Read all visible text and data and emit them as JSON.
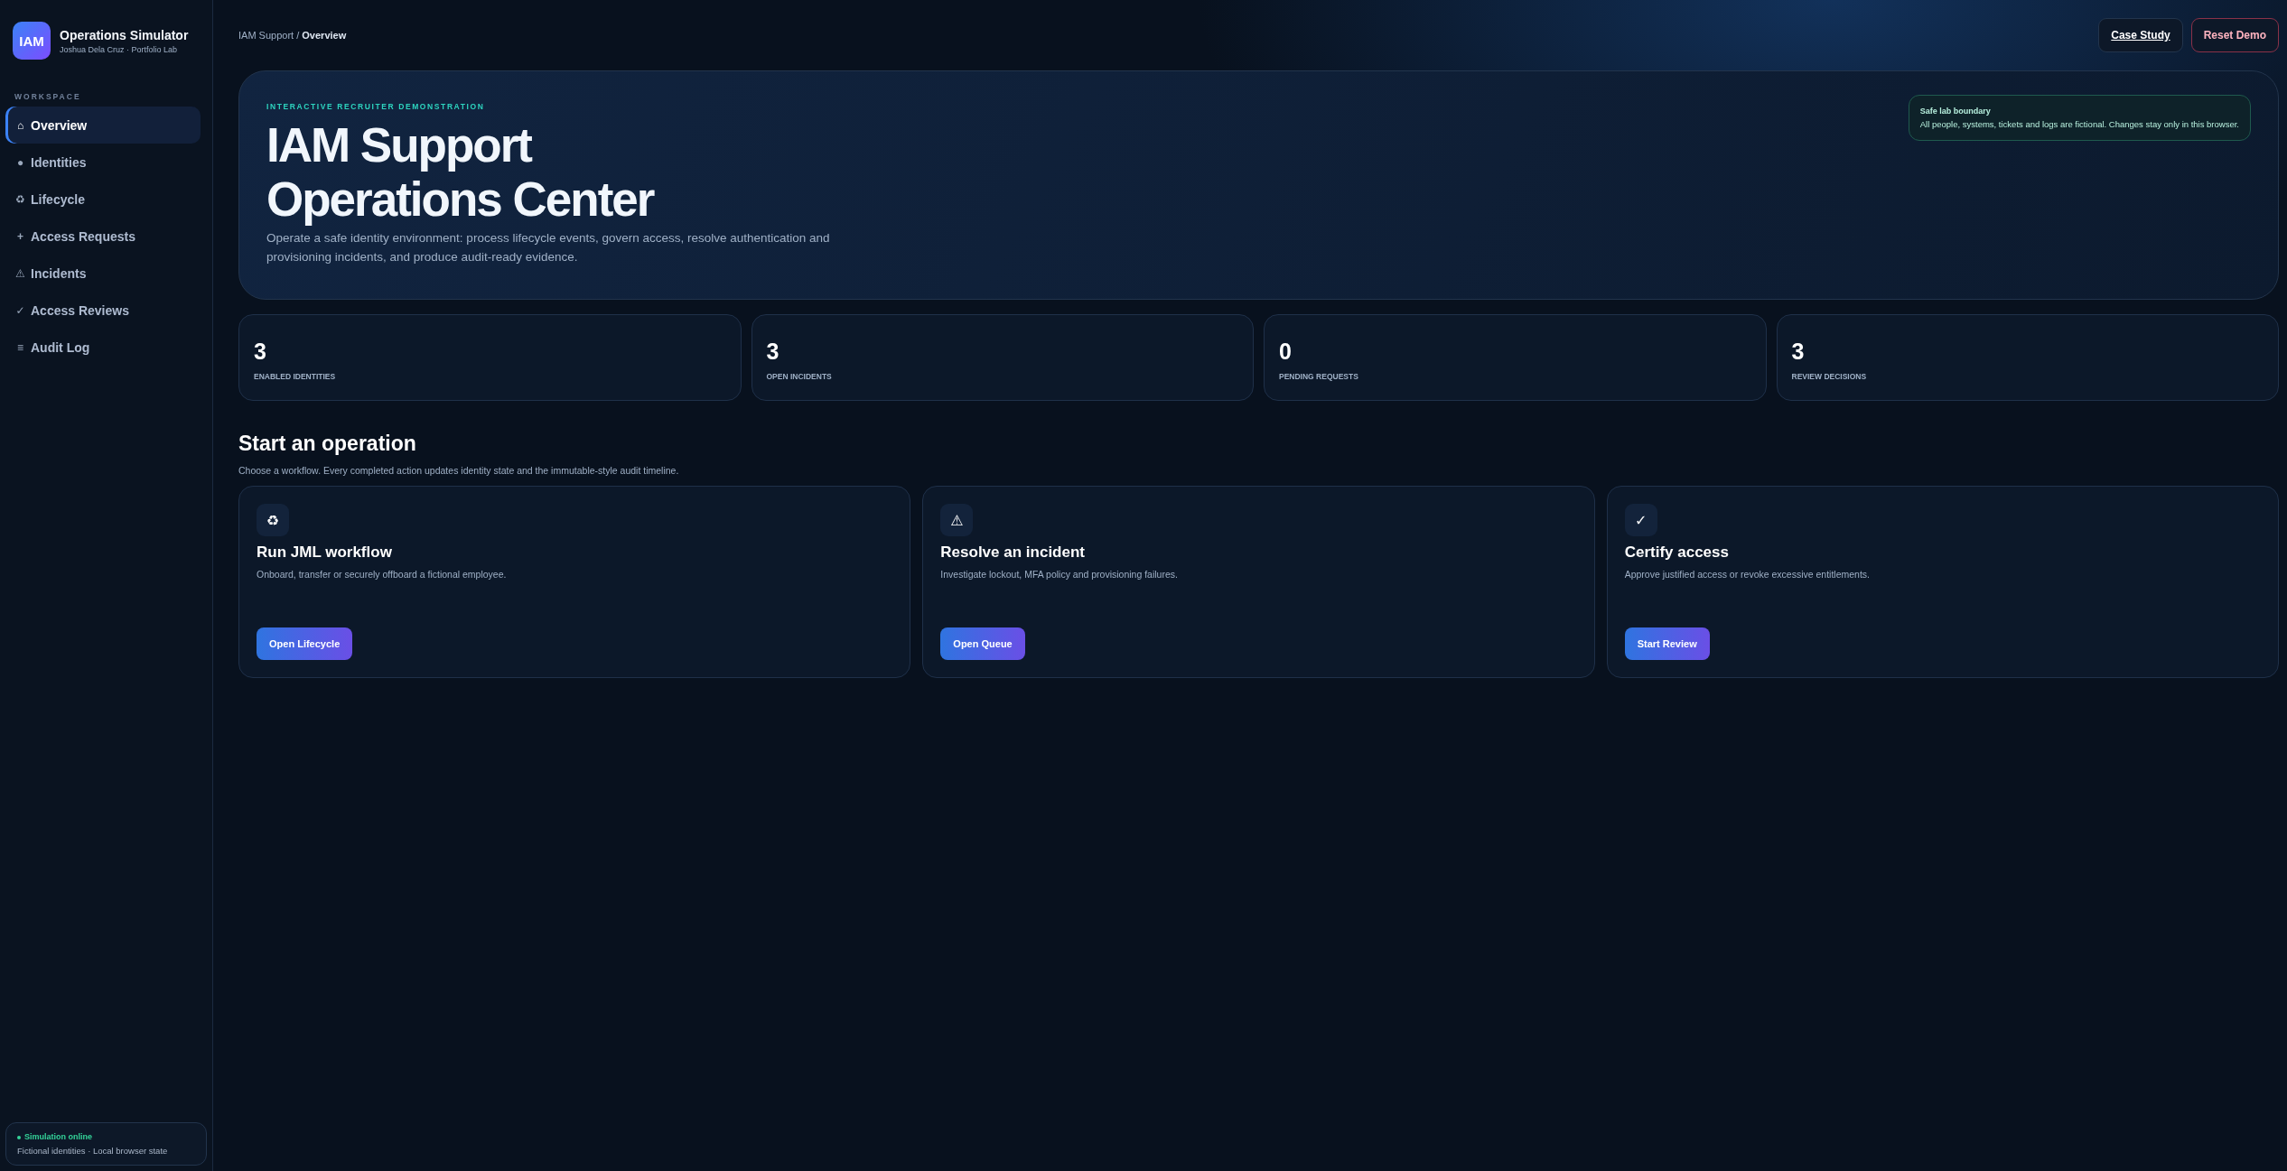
{
  "brand": {
    "logo": "IAM",
    "title": "Operations Simulator",
    "subtitle": "Joshua Dela Cruz · Portfolio Lab"
  },
  "sidebar": {
    "section": "WORKSPACE",
    "items": [
      {
        "icon": "⌂",
        "label": "Overview",
        "selected": true
      },
      {
        "icon": "●",
        "label": "Identities",
        "selected": false
      },
      {
        "icon": "♻",
        "label": "Lifecycle",
        "selected": false
      },
      {
        "icon": "+",
        "label": "Access Requests",
        "selected": false
      },
      {
        "icon": "⚠",
        "label": "Incidents",
        "selected": false
      },
      {
        "icon": "✓",
        "label": "Access Reviews",
        "selected": false
      },
      {
        "icon": "≡",
        "label": "Audit Log",
        "selected": false
      }
    ],
    "status": {
      "title": "Simulation online",
      "detail": "Fictional identities · Local browser state"
    }
  },
  "breadcrumb": {
    "parent": "IAM Support",
    "separator": "/",
    "current": "Overview"
  },
  "header_buttons": [
    {
      "label": "Case Study",
      "kind": "link"
    },
    {
      "label": "Reset Demo",
      "kind": "danger"
    }
  ],
  "hero": {
    "eyebrow": "INTERACTIVE RECRUITER DEMONSTRATION",
    "title_lines": [
      "IAM Support",
      "Operations Center"
    ],
    "description": "Operate a safe identity environment: process lifecycle events, govern access, resolve authentication and provisioning incidents, and produce audit-ready evidence.",
    "notice": {
      "title": "Safe lab boundary",
      "text": "All people, systems, tickets and logs are fictional. Changes stay only in this browser."
    }
  },
  "stats": [
    {
      "value": "3",
      "label": "ENABLED IDENTITIES"
    },
    {
      "value": "3",
      "label": "OPEN INCIDENTS"
    },
    {
      "value": "0",
      "label": "PENDING REQUESTS"
    },
    {
      "value": "3",
      "label": "REVIEW DECISIONS"
    }
  ],
  "operations": {
    "title": "Start an operation",
    "subtitle": "Choose a workflow. Every completed action updates identity state and the immutable-style audit timeline.",
    "cards": [
      {
        "icon": "♻",
        "title": "Run JML workflow",
        "text": "Onboard, transfer or securely offboard a fictional employee.",
        "button": "Open Lifecycle"
      },
      {
        "icon": "⚠",
        "title": "Resolve an incident",
        "text": "Investigate lockout, MFA policy and provisioning failures.",
        "button": "Open Queue"
      },
      {
        "icon": "✓",
        "title": "Certify access",
        "text": "Approve justified access or revoke excessive entitlements.",
        "button": "Start Review"
      }
    ]
  }
}
